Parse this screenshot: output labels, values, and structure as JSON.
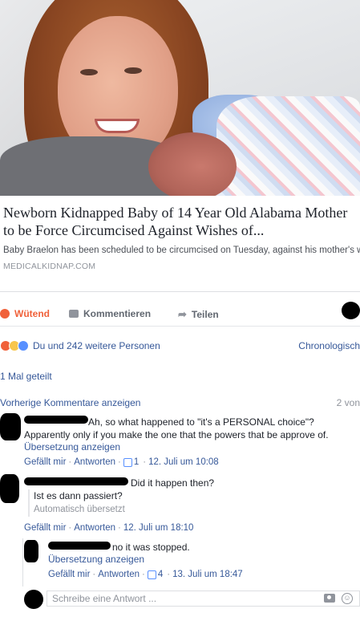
{
  "link_preview": {
    "title": "Newborn Kidnapped Baby of 14 Year Old Alabama Mother to be Force Circumcised Against Wishes of...",
    "description": "Baby Braelon has been scheduled to be circumcised on Tuesday, against his mother's wishes, according to the Save Braelon's Family Facebook page. Social...",
    "domain": "MEDICALKIDNAP.COM"
  },
  "actions": {
    "react_label": "Wütend",
    "comment_label": "Kommentieren",
    "share_label": "Teilen"
  },
  "reactions": {
    "summary": "Du und 242 weitere Personen",
    "sort_label": "Chronologisch"
  },
  "shared_count": "1 Mal geteilt",
  "comments_header": {
    "previous_label": "Vorherige Kommentare anzeigen",
    "count": "2 von"
  },
  "comments": [
    {
      "line1": "Ah, so what happened to \"it's a PERSONAL choice\"?",
      "line2": "Apparently only if you make the one that the powers that be approve of.",
      "translate": "Übersetzung anzeigen",
      "like": "Gefällt mir",
      "reply": "Antworten",
      "likes": "1",
      "time": "12. Juli um 10:08"
    },
    {
      "line1": "Did it happen then?",
      "translation": "Ist es dann passiert?",
      "auto_translated": "Automatisch übersetzt",
      "like": "Gefällt mir",
      "reply": "Antworten",
      "time": "12. Juli um 18:10"
    },
    {
      "line1": "no it was stopped.",
      "translate": "Übersetzung anzeigen",
      "like": "Gefällt mir",
      "reply": "Antworten",
      "likes": "4",
      "time": "13. Juli um 18:47"
    }
  ],
  "reply_input": {
    "placeholder": "Schreibe eine Antwort ..."
  },
  "colors": {
    "link": "#365899",
    "muted": "#90949c",
    "angry": "#f0613a"
  }
}
